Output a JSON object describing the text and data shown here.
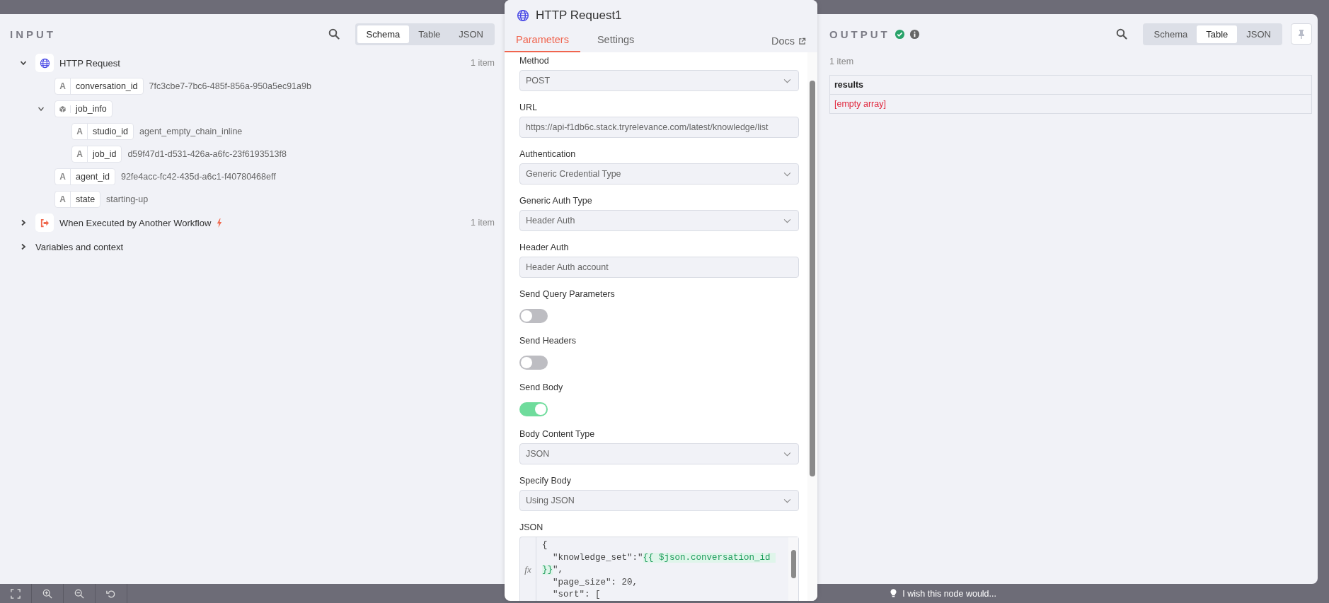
{
  "input_panel": {
    "title": "INPUT",
    "view_tabs": [
      {
        "label": "Schema",
        "selected": true
      },
      {
        "label": "Table",
        "selected": false
      },
      {
        "label": "JSON",
        "selected": false
      }
    ],
    "nodes": [
      {
        "name": "HTTP Request",
        "trigger": false,
        "count": "1 item",
        "expanded": true,
        "fields": [
          {
            "kind": "string",
            "type_label": "A",
            "key": "conversation_id",
            "value": "7fc3cbe7-7bc6-485f-856a-950a5ec91a9b"
          },
          {
            "kind": "object",
            "key": "job_info",
            "expanded": true,
            "children": [
              {
                "kind": "string",
                "type_label": "A",
                "key": "studio_id",
                "value": "agent_empty_chain_inline"
              },
              {
                "kind": "string",
                "type_label": "A",
                "key": "job_id",
                "value": "d59f47d1-d531-426a-a6fc-23f6193513f8"
              }
            ]
          },
          {
            "kind": "string",
            "type_label": "A",
            "key": "agent_id",
            "value": "92fe4acc-fc42-435d-a6c1-f40780468eff"
          },
          {
            "kind": "string",
            "type_label": "A",
            "key": "state",
            "value": "starting-up"
          }
        ]
      },
      {
        "name": "When Executed by Another Workflow",
        "trigger": true,
        "count": "1 item",
        "expanded": false
      }
    ],
    "variables": {
      "label": "Variables and context",
      "expanded": false
    }
  },
  "node_panel": {
    "title": "HTTP Request1",
    "tabs": [
      {
        "label": "Parameters",
        "selected": true
      },
      {
        "label": "Settings",
        "selected": false
      }
    ],
    "docs_link": "Docs",
    "params": [
      {
        "kind": "select",
        "label": "Method",
        "value": "POST"
      },
      {
        "kind": "input",
        "label": "URL",
        "value": "https://api-f1db6c.stack.tryrelevance.com/latest/knowledge/list"
      },
      {
        "kind": "select",
        "label": "Authentication",
        "value": "Generic Credential Type"
      },
      {
        "kind": "select",
        "label": "Generic Auth Type",
        "value": "Header Auth"
      },
      {
        "kind": "input",
        "label": "Header Auth",
        "value": "Header Auth account"
      },
      {
        "kind": "toggle",
        "label": "Send Query Parameters",
        "on": false
      },
      {
        "kind": "toggle",
        "label": "Send Headers",
        "on": false
      },
      {
        "kind": "toggle",
        "label": "Send Body",
        "on": true
      },
      {
        "kind": "select",
        "label": "Body Content Type",
        "value": "JSON"
      },
      {
        "kind": "select",
        "label": "Specify Body",
        "value": "Using JSON"
      },
      {
        "kind": "code",
        "label": "JSON",
        "gutter": "fx",
        "lines": [
          [
            {
              "kind": "text",
              "text": "{"
            }
          ],
          [
            {
              "kind": "text",
              "text": "  \"knowledge_set\":\""
            },
            {
              "kind": "expression",
              "text": "{{ $json.conversation_id "
            }
          ],
          [
            {
              "kind": "expression",
              "text": "}}"
            },
            {
              "kind": "text",
              "text": "\","
            }
          ],
          [
            {
              "kind": "text",
              "text": "  \"page_size\": 20,"
            }
          ],
          [
            {
              "kind": "text",
              "text": "  \"sort\": ["
            }
          ]
        ]
      }
    ]
  },
  "output_panel": {
    "title": "OUTPUT",
    "succeeded": true,
    "view_tabs": [
      {
        "label": "Schema",
        "selected": false
      },
      {
        "label": "Table",
        "selected": true
      },
      {
        "label": "JSON",
        "selected": false
      }
    ],
    "item_count": "1 item",
    "table": {
      "columns": [
        "results"
      ],
      "rows": [
        [
          {
            "kind": "empty",
            "text": "[empty array]"
          }
        ]
      ]
    }
  },
  "canvas_bar": {
    "feedback": "I wish this node would..."
  }
}
